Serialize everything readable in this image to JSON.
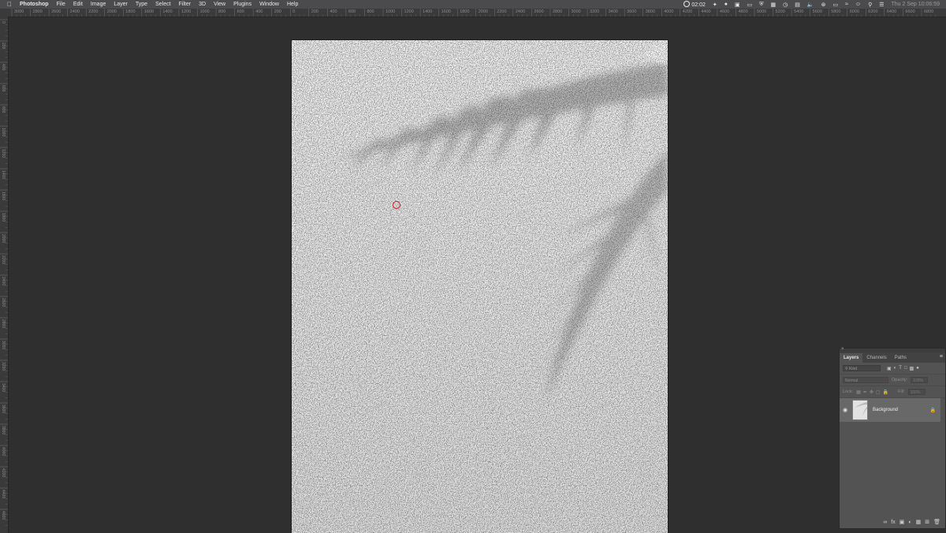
{
  "menubar": {
    "apple_icon": "apple-icon",
    "items": [
      "Photoshop",
      "File",
      "Edit",
      "Image",
      "Layer",
      "Type",
      "Select",
      "Filter",
      "3D",
      "View",
      "Plugins",
      "Window",
      "Help"
    ],
    "timer": "02:02",
    "clock": "Thu 2 Sep  10:06:59"
  },
  "ruler": {
    "h_labels": [
      "3000",
      "2800",
      "2600",
      "2400",
      "2200",
      "2000",
      "1800",
      "1600",
      "1400",
      "1200",
      "1000",
      "800",
      "600",
      "400",
      "200",
      "0",
      "200",
      "400",
      "600",
      "800",
      "1000",
      "1200",
      "1400",
      "1600",
      "1800",
      "2000",
      "2200",
      "2400",
      "2600",
      "2800",
      "3000",
      "3200",
      "3400",
      "3600",
      "3800",
      "4000",
      "4200",
      "4400",
      "4600",
      "4800",
      "5000",
      "5200",
      "5400",
      "5600",
      "5800",
      "6000",
      "6200",
      "6400",
      "6600",
      "6800"
    ],
    "v_labels": [
      "0",
      "200",
      "400",
      "600",
      "800",
      "1000",
      "1200",
      "1400",
      "1600",
      "1800",
      "2000",
      "2200",
      "2400",
      "2600",
      "2800",
      "3000",
      "3200",
      "3400",
      "3600",
      "3800",
      "4000",
      "4200",
      "4400",
      "4600"
    ]
  },
  "layers_panel": {
    "tabs": [
      "Layers",
      "Channels",
      "Paths"
    ],
    "active_tab": "Layers",
    "filter_kind_placeholder": "Kind",
    "blend_mode": "Normal",
    "opacity_label": "Opacity:",
    "opacity_value": "100%",
    "lock_label": "Lock:",
    "fill_label": "Fill:",
    "fill_value": "100%",
    "layer": {
      "name": "Background"
    },
    "bottom_icons": [
      "link-icon",
      "fx-icon",
      "mask-icon",
      "adjustment-icon",
      "group-folder-icon",
      "new-layer-icon",
      "trash-icon"
    ]
  },
  "colors": {
    "workspace": "#2f2f2f",
    "panel": "#535353",
    "cursor_ring": "#d1141b"
  }
}
